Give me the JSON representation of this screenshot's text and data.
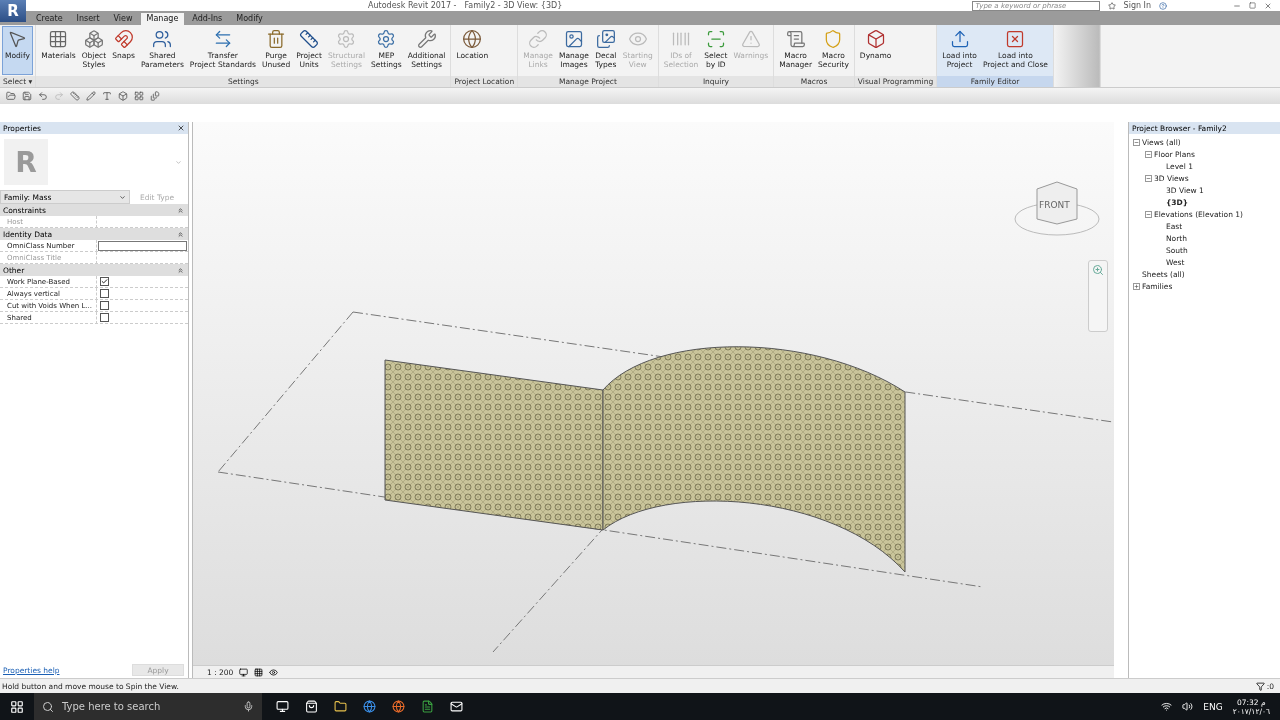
{
  "title_bar": {
    "logo": "R",
    "app_title": "Autodesk Revit 2017 -",
    "doc_title": "Family2 - 3D View: {3D}",
    "search": {
      "placeholder": "Type a keyword or phrase"
    },
    "sign_in": "Sign In"
  },
  "tabs": [
    {
      "label": "Create",
      "selected": false
    },
    {
      "label": "Insert",
      "selected": false
    },
    {
      "label": "View",
      "selected": false
    },
    {
      "label": "Manage",
      "selected": true
    },
    {
      "label": "Add-Ins",
      "selected": false
    },
    {
      "label": "Modify",
      "selected": false
    }
  ],
  "ribbon": [
    {
      "title": "Select ▾",
      "highlighted": false,
      "tools": [
        {
          "lines": [
            "Modify"
          ],
          "disabled": false,
          "selected": true
        }
      ]
    },
    {
      "title": "Settings",
      "highlighted": false,
      "tools": [
        {
          "lines": [
            "Materials"
          ],
          "disabled": false,
          "selected": false
        },
        {
          "lines": [
            "Object",
            "Styles"
          ],
          "disabled": false,
          "selected": false
        },
        {
          "lines": [
            "Snaps"
          ],
          "disabled": false,
          "selected": false
        },
        {
          "lines": [
            "Shared",
            "Parameters"
          ],
          "disabled": false,
          "selected": false
        },
        {
          "lines": [
            "Transfer",
            "Project Standards"
          ],
          "disabled": false,
          "selected": false
        },
        {
          "lines": [
            "Purge",
            "Unused"
          ],
          "disabled": false,
          "selected": false
        },
        {
          "lines": [
            "Project",
            "Units"
          ],
          "disabled": false,
          "selected": false
        },
        {
          "lines": [
            "Structural",
            "Settings"
          ],
          "disabled": true,
          "selected": false
        },
        {
          "lines": [
            "MEP",
            "Settings"
          ],
          "disabled": false,
          "selected": false
        },
        {
          "lines": [
            "Additional",
            "Settings"
          ],
          "disabled": false,
          "selected": false
        }
      ]
    },
    {
      "title": "Project Location",
      "highlighted": false,
      "tools": [
        {
          "lines": [
            "Location"
          ],
          "disabled": false,
          "selected": false
        }
      ]
    },
    {
      "title": "Manage Project",
      "highlighted": false,
      "tools": [
        {
          "lines": [
            "Manage",
            "Links"
          ],
          "disabled": true,
          "selected": false
        },
        {
          "lines": [
            "Manage",
            "Images"
          ],
          "disabled": false,
          "selected": false
        },
        {
          "lines": [
            "Decal",
            "Types"
          ],
          "disabled": false,
          "selected": false
        },
        {
          "lines": [
            "Starting",
            "View"
          ],
          "disabled": true,
          "selected": false
        }
      ]
    },
    {
      "title": "Inquiry",
      "highlighted": false,
      "tools": [
        {
          "lines": [
            "IDs of",
            "Selection"
          ],
          "disabled": true,
          "selected": false
        },
        {
          "lines": [
            "Select",
            "by ID"
          ],
          "disabled": false,
          "selected": false
        },
        {
          "lines": [
            "Warnings"
          ],
          "disabled": true,
          "selected": false
        }
      ]
    },
    {
      "title": "Macros",
      "highlighted": false,
      "tools": [
        {
          "lines": [
            "Macro",
            "Manager"
          ],
          "disabled": false,
          "selected": false
        },
        {
          "lines": [
            "Macro",
            "Security"
          ],
          "disabled": false,
          "selected": false
        }
      ]
    },
    {
      "title": "Visual Programming",
      "highlighted": false,
      "tools": [
        {
          "lines": [
            "Dynamo"
          ],
          "disabled": false,
          "selected": false
        }
      ]
    },
    {
      "title": "Family Editor",
      "highlighted": true,
      "tools": [
        {
          "lines": [
            "Load into",
            "Project"
          ],
          "disabled": false,
          "selected": false
        },
        {
          "lines": [
            "Load into",
            "Project and Close"
          ],
          "disabled": false,
          "selected": false
        }
      ]
    }
  ],
  "properties": {
    "title": "Properties",
    "preview_letter": "R",
    "family": "Family: Mass",
    "edit_type": "Edit Type",
    "groups": [
      {
        "title": "Constraints",
        "rows": [
          {
            "label": "Host",
            "kind": "text",
            "disabled": true
          }
        ]
      },
      {
        "title": "Identity Data",
        "rows": [
          {
            "label": "OmniClass Number",
            "kind": "field",
            "disabled": false
          },
          {
            "label": "OmniClass Title",
            "kind": "text",
            "disabled": true
          }
        ]
      },
      {
        "title": "Other",
        "rows": [
          {
            "label": "Work Plane-Based",
            "kind": "checkbox",
            "disabled": false,
            "checked": true
          },
          {
            "label": "Always vertical",
            "kind": "checkbox",
            "disabled": false,
            "checked": false
          },
          {
            "label": "Cut with Voids When L...",
            "kind": "checkbox",
            "disabled": false,
            "checked": false
          },
          {
            "label": "Shared",
            "kind": "checkbox",
            "disabled": false,
            "checked": false
          }
        ]
      }
    ],
    "help": "Properties help",
    "apply": "Apply"
  },
  "viewport": {
    "view_cube": "FRONT",
    "scale": "1 : 200"
  },
  "project_browser": {
    "title": "Project Browser - Family2",
    "tree": [
      {
        "label": "Views (all)",
        "expanded": true,
        "selected": false,
        "children": [
          {
            "label": "Floor Plans",
            "expanded": true,
            "selected": false,
            "children": [
              {
                "label": "Level 1",
                "selected": false
              }
            ]
          },
          {
            "label": "3D Views",
            "expanded": true,
            "selected": false,
            "children": [
              {
                "label": "3D View 1",
                "selected": false
              },
              {
                "label": "{3D}",
                "selected": true
              }
            ]
          },
          {
            "label": "Elevations (Elevation 1)",
            "expanded": true,
            "selected": false,
            "children": [
              {
                "label": "East",
                "selected": false
              },
              {
                "label": "North",
                "selected": false
              },
              {
                "label": "South",
                "selected": false
              },
              {
                "label": "West",
                "selected": false
              }
            ]
          }
        ]
      },
      {
        "label": "Sheets (all)",
        "selected": false
      },
      {
        "label": "Families",
        "expanded": false,
        "selected": false
      }
    ]
  },
  "status_bar": {
    "message": "Hold button and move mouse to Spin the View.",
    "filter_count": ":0"
  },
  "taskbar": {
    "search": {
      "placeholder": "Type here to search"
    },
    "language": "ENG",
    "time": "07:32 م",
    "date": "٢٠١٧/١٢/٠٦"
  }
}
